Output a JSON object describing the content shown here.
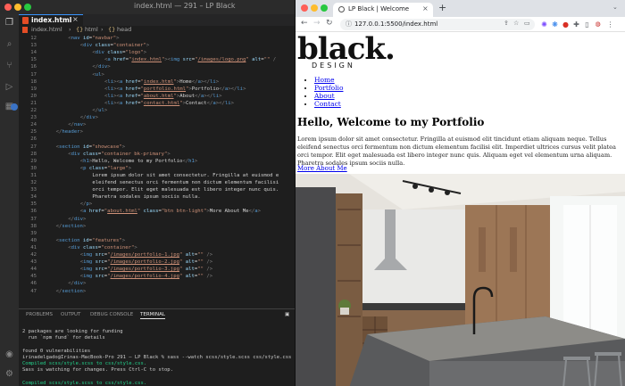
{
  "vscode": {
    "window_title": "index.html — 291 – LP Black",
    "tab_label": "index.html",
    "tab_close": "×",
    "breadcrumb": [
      "index.html",
      "›",
      "html",
      "›",
      "head"
    ],
    "code_lines": [
      {
        "n": "12",
        "html": "<span class=\"p\">&lt;</span><span class=\"t\">nav</span> <span class=\"a\">id</span><span class=\"x\">=</span><span class=\"s\">\"navbar\"</span><span class=\"p\">&gt;</span>",
        "indent": 8
      },
      {
        "n": "13",
        "html": "<span class=\"p\">&lt;</span><span class=\"t\">div</span> <span class=\"a\">class</span><span class=\"x\">=</span><span class=\"s\">\"container\"</span><span class=\"p\">&gt;</span>",
        "indent": 12
      },
      {
        "n": "14",
        "html": "<span class=\"p\">&lt;</span><span class=\"t\">div</span> <span class=\"a\">class</span><span class=\"x\">=</span><span class=\"s\">\"logo\"</span><span class=\"p\">&gt;</span>",
        "indent": 16
      },
      {
        "n": "15",
        "html": "<span class=\"p\">&lt;</span><span class=\"t\">a</span> <span class=\"a\">href</span><span class=\"x\">=</span><span class=\"s\">\"<span class=\"u\">index.html</span>\"</span><span class=\"p\">&gt;&lt;</span><span class=\"t\">img</span> <span class=\"a\">src</span><span class=\"x\">=</span><span class=\"s\">\"<span class=\"u\">/images/logo.png</span>\"</span> <span class=\"a\">alt</span><span class=\"x\">=</span><span class=\"s\">\"\"</span> <span class=\"p\">/</span>",
        "indent": 20
      },
      {
        "n": "16",
        "html": "<span class=\"p\">&lt;/</span><span class=\"t\">div</span><span class=\"p\">&gt;</span>",
        "indent": 16
      },
      {
        "n": "17",
        "html": "<span class=\"p\">&lt;</span><span class=\"t\">ul</span><span class=\"p\">&gt;</span>",
        "indent": 16
      },
      {
        "n": "18",
        "html": "<span class=\"p\">&lt;</span><span class=\"t\">li</span><span class=\"p\">&gt;&lt;</span><span class=\"t\">a</span> <span class=\"a\">href</span><span class=\"x\">=</span><span class=\"s\">\"<span class=\"u\">index.html</span>\"</span><span class=\"p\">&gt;</span><span class=\"x\">Home</span><span class=\"p\">&lt;/</span><span class=\"t\">a</span><span class=\"p\">&gt;&lt;/</span><span class=\"t\">li</span><span class=\"p\">&gt;</span>",
        "indent": 20
      },
      {
        "n": "19",
        "html": "<span class=\"p\">&lt;</span><span class=\"t\">li</span><span class=\"p\">&gt;&lt;</span><span class=\"t\">a</span> <span class=\"a\">href</span><span class=\"x\">=</span><span class=\"s\">\"<span class=\"u\">portfolio.html</span>\"</span><span class=\"p\">&gt;</span><span class=\"x\">Portfolio</span><span class=\"p\">&lt;/</span><span class=\"t\">a</span><span class=\"p\">&gt;&lt;/</span><span class=\"t\">li</span><span class=\"p\">&gt;</span>",
        "indent": 20
      },
      {
        "n": "20",
        "html": "<span class=\"p\">&lt;</span><span class=\"t\">li</span><span class=\"p\">&gt;&lt;</span><span class=\"t\">a</span> <span class=\"a\">href</span><span class=\"x\">=</span><span class=\"s\">\"<span class=\"u\">about.html</span>\"</span><span class=\"p\">&gt;</span><span class=\"x\">About</span><span class=\"p\">&lt;/</span><span class=\"t\">a</span><span class=\"p\">&gt;&lt;/</span><span class=\"t\">li</span><span class=\"p\">&gt;</span>",
        "indent": 20
      },
      {
        "n": "21",
        "html": "<span class=\"p\">&lt;</span><span class=\"t\">li</span><span class=\"p\">&gt;&lt;</span><span class=\"t\">a</span> <span class=\"a\">href</span><span class=\"x\">=</span><span class=\"s\">\"<span class=\"u\">contact.html</span>\"</span><span class=\"p\">&gt;</span><span class=\"x\">Contact</span><span class=\"p\">&lt;/</span><span class=\"t\">a</span><span class=\"p\">&gt;&lt;/</span><span class=\"t\">li</span><span class=\"p\">&gt;</span>",
        "indent": 20
      },
      {
        "n": "22",
        "html": "<span class=\"p\">&lt;/</span><span class=\"t\">ul</span><span class=\"p\">&gt;</span>",
        "indent": 16
      },
      {
        "n": "23",
        "html": "<span class=\"p\">&lt;/</span><span class=\"t\">div</span><span class=\"p\">&gt;</span>",
        "indent": 12
      },
      {
        "n": "24",
        "html": "<span class=\"p\">&lt;/</span><span class=\"t\">nav</span><span class=\"p\">&gt;</span>",
        "indent": 8
      },
      {
        "n": "25",
        "html": "<span class=\"p\">&lt;/</span><span class=\"t\">header</span><span class=\"p\">&gt;</span>",
        "indent": 4
      },
      {
        "n": "26",
        "html": "",
        "indent": 0
      },
      {
        "n": "27",
        "html": "<span class=\"p\">&lt;</span><span class=\"t\">section</span> <span class=\"a\">id</span><span class=\"x\">=</span><span class=\"s\">\"showcase\"</span><span class=\"p\">&gt;</span>",
        "indent": 4
      },
      {
        "n": "28",
        "html": "<span class=\"p\">&lt;</span><span class=\"t\">div</span> <span class=\"a\">class</span><span class=\"x\">=</span><span class=\"s\">\"container bk-primary\"</span><span class=\"p\">&gt;</span>",
        "indent": 8
      },
      {
        "n": "29",
        "html": "<span class=\"p\">&lt;</span><span class=\"t\">h1</span><span class=\"p\">&gt;</span><span class=\"x\">Hello, Welcome to my Portfolio</span><span class=\"p\">&lt;/</span><span class=\"t\">h1</span><span class=\"p\">&gt;</span>",
        "indent": 12
      },
      {
        "n": "30",
        "html": "<span class=\"p\">&lt;</span><span class=\"t\">p</span> <span class=\"a\">class</span><span class=\"x\">=</span><span class=\"s\">\"large\"</span><span class=\"p\">&gt;</span>",
        "indent": 12
      },
      {
        "n": "31",
        "html": "<span class=\"x\">Lorem ipsum dolor sit amet consectetur. Fringilla at euismod e</span>",
        "indent": 16
      },
      {
        "n": "32",
        "html": "<span class=\"x\">eleifend senectus orci fermentum non dictum elementum facilisi</span>",
        "indent": 16
      },
      {
        "n": "33",
        "html": "<span class=\"x\">orci tempor. Elit eget malesuada est libero integer nunc quis.</span>",
        "indent": 16
      },
      {
        "n": "34",
        "html": "<span class=\"x\">Pharetra sodales ipsum sociis nulla.</span>",
        "indent": 16
      },
      {
        "n": "35",
        "html": "<span class=\"p\">&lt;/</span><span class=\"t\">p</span><span class=\"p\">&gt;</span>",
        "indent": 12
      },
      {
        "n": "36",
        "html": "<span class=\"p\">&lt;</span><span class=\"t\">a</span> <span class=\"a\">href</span><span class=\"x\">=</span><span class=\"s\">\"<span class=\"u\">about.html</span>\"</span> <span class=\"a\">class</span><span class=\"x\">=</span><span class=\"s\">\"btn btn-light\"</span><span class=\"p\">&gt;</span><span class=\"x\">More About Me</span><span class=\"p\">&lt;/</span><span class=\"t\">a</span><span class=\"p\">&gt;</span>",
        "indent": 12
      },
      {
        "n": "37",
        "html": "<span class=\"p\">&lt;/</span><span class=\"t\">div</span><span class=\"p\">&gt;</span>",
        "indent": 8
      },
      {
        "n": "38",
        "html": "<span class=\"p\">&lt;/</span><span class=\"t\">section</span><span class=\"p\">&gt;</span>",
        "indent": 4
      },
      {
        "n": "39",
        "html": "",
        "indent": 0
      },
      {
        "n": "40",
        "html": "<span class=\"p\">&lt;</span><span class=\"t\">section</span> <span class=\"a\">id</span><span class=\"x\">=</span><span class=\"s\">\"features\"</span><span class=\"p\">&gt;</span>",
        "indent": 4
      },
      {
        "n": "41",
        "html": "<span class=\"p\">&lt;</span><span class=\"t\">div</span> <span class=\"a\">class</span><span class=\"x\">=</span><span class=\"s\">\"container\"</span><span class=\"p\">&gt;</span>",
        "indent": 8
      },
      {
        "n": "42",
        "html": "<span class=\"p\">&lt;</span><span class=\"t\">img</span> <span class=\"a\">src</span><span class=\"x\">=</span><span class=\"s\">\"<span class=\"u\">/images/portfolio-1.jpg</span>\"</span> <span class=\"a\">alt</span><span class=\"x\">=</span><span class=\"s\">\"\"</span> <span class=\"p\">/&gt;</span>",
        "indent": 12
      },
      {
        "n": "43",
        "html": "<span class=\"p\">&lt;</span><span class=\"t\">img</span> <span class=\"a\">src</span><span class=\"x\">=</span><span class=\"s\">\"<span class=\"u\">/images/portfolio-2.jpg</span>\"</span> <span class=\"a\">alt</span><span class=\"x\">=</span><span class=\"s\">\"\"</span> <span class=\"p\">/&gt;</span>",
        "indent": 12
      },
      {
        "n": "44",
        "html": "<span class=\"p\">&lt;</span><span class=\"t\">img</span> <span class=\"a\">src</span><span class=\"x\">=</span><span class=\"s\">\"<span class=\"u\">/images/portfolio-3.jpg</span>\"</span> <span class=\"a\">alt</span><span class=\"x\">=</span><span class=\"s\">\"\"</span> <span class=\"p\">/&gt;</span>",
        "indent": 12
      },
      {
        "n": "45",
        "html": "<span class=\"p\">&lt;</span><span class=\"t\">img</span> <span class=\"a\">src</span><span class=\"x\">=</span><span class=\"s\">\"<span class=\"u\">/images/portfolio-4.jpg</span>\"</span> <span class=\"a\">alt</span><span class=\"x\">=</span><span class=\"s\">\"\"</span> <span class=\"p\">/&gt;</span>",
        "indent": 12
      },
      {
        "n": "46",
        "html": "<span class=\"p\">&lt;/</span><span class=\"t\">div</span><span class=\"p\">&gt;</span>",
        "indent": 8
      },
      {
        "n": "47",
        "html": "<span class=\"p\">&lt;/</span><span class=\"t\">section</span><span class=\"p\">&gt;</span>",
        "indent": 4
      }
    ],
    "panel_tabs": [
      "PROBLEMS",
      "OUTPUT",
      "DEBUG CONSOLE",
      "TERMINAL"
    ],
    "terminal_lines": [
      {
        "text": "",
        "green": false
      },
      {
        "text": "2 packages are looking for funding",
        "green": false
      },
      {
        "text": "  run `npm fund` for details",
        "green": false
      },
      {
        "text": "",
        "green": false
      },
      {
        "text": "found 0 vulnerabilities",
        "green": false
      },
      {
        "text": "irinadelgado@Irinas-MacBook-Pro 291 – LP Black % sass --watch scss/style.scss css/style.css",
        "green": false
      },
      {
        "text": "Compiled scss/style.scss to css/style.css.",
        "green": true
      },
      {
        "text": "Sass is watching for changes. Press Ctrl-C to stop.",
        "green": false
      },
      {
        "text": "",
        "green": false
      },
      {
        "text": "Compiled scss/style.scss to css/style.css.",
        "green": true
      }
    ]
  },
  "browser": {
    "tab_title": "LP Black | Welcome",
    "tab_close": "×",
    "new_tab": "+",
    "url": "127.0.0.1:5500/index.html",
    "page": {
      "logo_text": "black.",
      "logo_sub": "DESIGN",
      "nav_links": [
        "Home",
        "Portfolio",
        "About",
        "Contact"
      ],
      "heading": "Hello, Welcome to my Portfolio",
      "lead": "Lorem ipsum dolor sit amet consectetur. Fringilla at euismod elit tincidunt etiam aliquam neque. Tellus eleifend senectus orci fermentum non dictum elementum facilisi elit. Imperdiet ultrices cursus velit platea orci tempor. Elit eget malesuada est libero integer nunc quis. Aliquam eget vel elementum urna aliquam. Pharetra sodales ipsum sociis nulla.",
      "more_link": "More About Me"
    }
  },
  "colors": {
    "vscode_bg": "#1e1e1e",
    "accent_blue": "#3794ff",
    "terminal_green": "#23d18b",
    "link_blue": "#0000ee"
  }
}
